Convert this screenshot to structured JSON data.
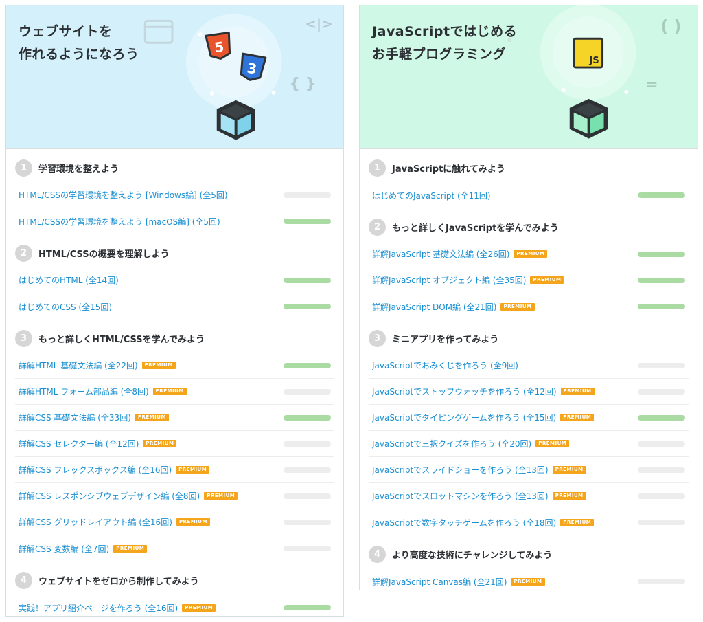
{
  "premium_label": "PREMIUM",
  "colors": {
    "card1_header_bg": "#d4f1fb",
    "card2_header_bg": "#d0f8e6",
    "link": "#1a8fd1",
    "premium_badge": "#f4a51c",
    "progress_fill": "#a9dba3",
    "progress_track": "#ededed"
  },
  "cards": [
    {
      "title_lines": [
        "ウェブサイトを",
        "作れるようになろう"
      ],
      "hero_icons": [
        "html5-badge-icon",
        "css3-badge-icon",
        "browser-window-icon",
        "code-tag-icon",
        "curly-braces-icon",
        "cube-icon"
      ],
      "hero_text": {
        "html5": "5",
        "css3": "3",
        "tag": "<|>",
        "braces": "{ }"
      },
      "sections": [
        {
          "num": "1",
          "title": "学習環境を整えよう",
          "courses": [
            {
              "title": "HTML/CSSの学習環境を整えよう [Windows編] (全5回)",
              "premium": false,
              "progress": 0
            },
            {
              "title": "HTML/CSSの学習環境を整えよう [macOS編] (全5回)",
              "premium": false,
              "progress": 1
            }
          ]
        },
        {
          "num": "2",
          "title": "HTML/CSSの概要を理解しよう",
          "courses": [
            {
              "title": "はじめてのHTML (全14回)",
              "premium": false,
              "progress": 1
            },
            {
              "title": "はじめてのCSS (全15回)",
              "premium": false,
              "progress": 1
            }
          ]
        },
        {
          "num": "3",
          "title": "もっと詳しくHTML/CSSを学んでみよう",
          "courses": [
            {
              "title": "詳解HTML 基礎文法編 (全22回)",
              "premium": true,
              "progress": 1
            },
            {
              "title": "詳解HTML フォーム部品編 (全8回)",
              "premium": true,
              "progress": 0
            },
            {
              "title": "詳解CSS 基礎文法編 (全33回)",
              "premium": true,
              "progress": 1
            },
            {
              "title": "詳解CSS セレクター編 (全12回)",
              "premium": true,
              "progress": 0
            },
            {
              "title": "詳解CSS フレックスボックス編 (全16回)",
              "premium": true,
              "progress": 0
            },
            {
              "title": "詳解CSS レスポンシブウェブデザイン編 (全8回)",
              "premium": true,
              "progress": 0
            },
            {
              "title": "詳解CSS グリッドレイアウト編 (全16回)",
              "premium": true,
              "progress": 0
            },
            {
              "title": "詳解CSS 変数編 (全7回)",
              "premium": true,
              "progress": 0
            }
          ]
        },
        {
          "num": "4",
          "title": "ウェブサイトをゼロから制作してみよう",
          "courses": [
            {
              "title": "実践！アプリ紹介ページを作ろう (全16回)",
              "premium": true,
              "progress": 1
            }
          ]
        }
      ]
    },
    {
      "title_lines": [
        "JavaScriptではじめる",
        "お手軽プログラミング"
      ],
      "hero_icons": [
        "javascript-badge-icon",
        "parentheses-icon",
        "equals-icon",
        "cube-icon"
      ],
      "hero_text": {
        "js": "JS",
        "parens": "( )",
        "equals": "="
      },
      "sections": [
        {
          "num": "1",
          "title": "JavaScriptに触れてみよう",
          "courses": [
            {
              "title": "はじめてのJavaScript (全11回)",
              "premium": false,
              "progress": 1
            }
          ]
        },
        {
          "num": "2",
          "title": "もっと詳しくJavaScriptを学んでみよう",
          "courses": [
            {
              "title": "詳解JavaScript 基礎文法編 (全26回)",
              "premium": true,
              "progress": 1
            },
            {
              "title": "詳解JavaScript オブジェクト編 (全35回)",
              "premium": true,
              "progress": 1
            },
            {
              "title": "詳解JavaScript DOM編 (全21回)",
              "premium": true,
              "progress": 1
            }
          ]
        },
        {
          "num": "3",
          "title": "ミニアプリを作ってみよう",
          "courses": [
            {
              "title": "JavaScriptでおみくじを作ろう (全9回)",
              "premium": false,
              "progress": 0
            },
            {
              "title": "JavaScriptでストップウォッチを作ろう (全12回)",
              "premium": true,
              "progress": 0
            },
            {
              "title": "JavaScriptでタイピングゲームを作ろう (全15回)",
              "premium": true,
              "progress": 1
            },
            {
              "title": "JavaScriptで三択クイズを作ろう (全20回)",
              "premium": true,
              "progress": 0
            },
            {
              "title": "JavaScriptでスライドショーを作ろう (全13回)",
              "premium": true,
              "progress": 0
            },
            {
              "title": "JavaScriptでスロットマシンを作ろう (全13回)",
              "premium": true,
              "progress": 0
            },
            {
              "title": "JavaScriptで数字タッチゲームを作ろう (全18回)",
              "premium": true,
              "progress": 0
            }
          ]
        },
        {
          "num": "4",
          "title": "より高度な技術にチャレンジしてみよう",
          "courses": [
            {
              "title": "詳解JavaScript Canvas編 (全21回)",
              "premium": true,
              "progress": 0
            }
          ]
        }
      ]
    }
  ]
}
